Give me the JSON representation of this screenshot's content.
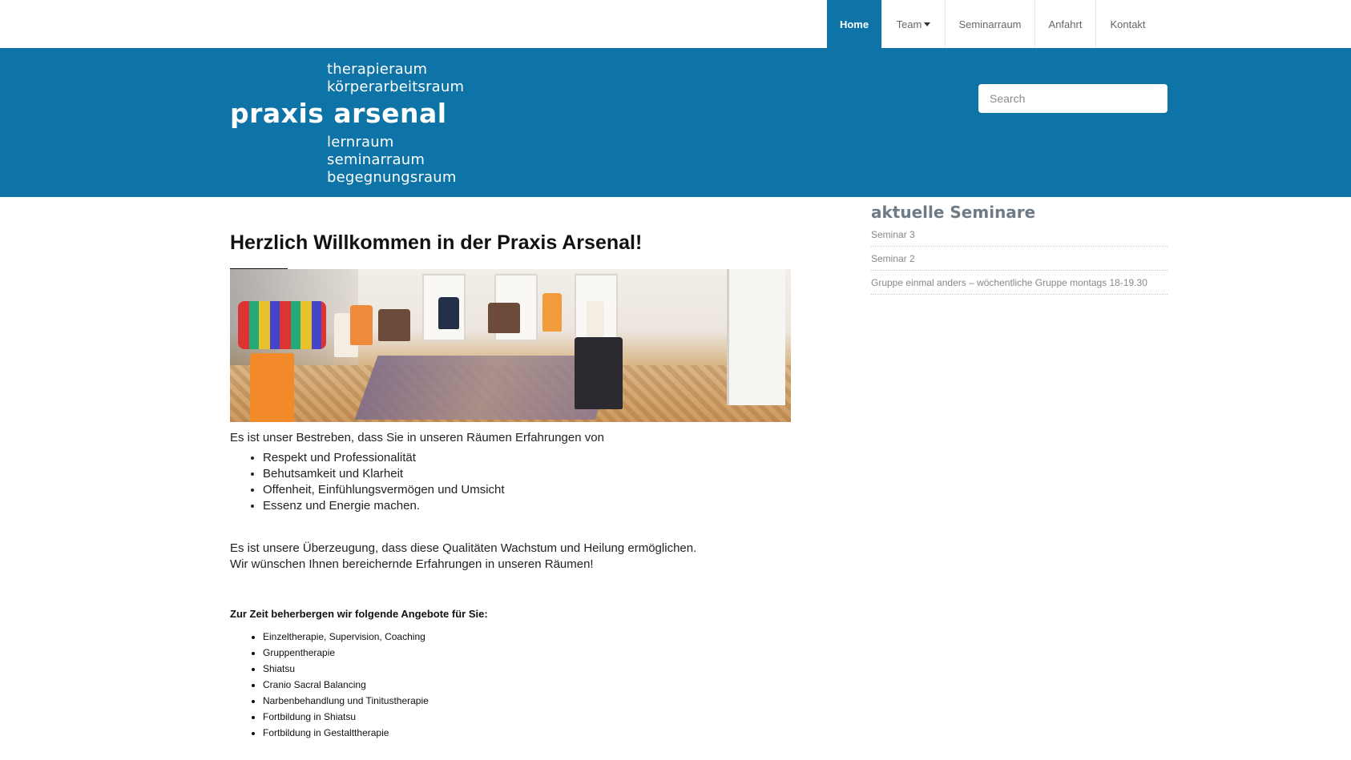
{
  "nav": {
    "items": [
      {
        "label": "Home",
        "active": true
      },
      {
        "label": "Team",
        "dropdown": true
      },
      {
        "label": "Seminarraum"
      },
      {
        "label": "Anfahrt"
      },
      {
        "label": "Kontakt"
      }
    ]
  },
  "header": {
    "logo_top": [
      "therapieraum",
      "körperarbeitsraum"
    ],
    "logo_brand": "praxis arsenal",
    "logo_bottom": [
      "lernraum",
      "seminarraum",
      "begegnungsraum"
    ],
    "search_placeholder": "Search",
    "background_color": "#0e74a8"
  },
  "main": {
    "title": "Herzlich Willkommen in der Praxis Arsenal!",
    "intro": "Es ist unser Bestreben, dass Sie in unseren Räumen Erfahrungen von",
    "values": [
      "Respekt und Professionalität",
      "Behutsamkeit und Klarheit",
      "Offenheit, Einfühlungsvermögen und Umsicht",
      "Essenz und Energie machen."
    ],
    "conviction_line1": "Es ist unsere Überzeugung, dass diese Qualitäten Wachstum und Heilung ermöglichen.",
    "conviction_line2": "Wir wünschen Ihnen bereichernde Erfahrungen in unseren Räumen!",
    "offers_heading": "Zur Zeit beherbergen wir folgende Angebote für Sie:",
    "offers": [
      "Einzeltherapie, Supervision, Coaching",
      "Gruppentherapie",
      "Shiatsu",
      "Cranio Sacral Balancing",
      "Narbenbehandlung und Tinitustherapie",
      "Fortbildung in Shiatsu",
      "Fortbildung in Gestalttherapie"
    ]
  },
  "sidebar": {
    "title": "aktuelle Seminare",
    "items": [
      "Seminar 3",
      "Seminar 2",
      "Gruppe einmal anders – wöchentliche Gruppe montags 18-19.30"
    ]
  }
}
